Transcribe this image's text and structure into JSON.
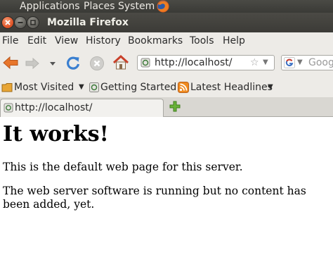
{
  "panel": {
    "applications": "Applications",
    "places": "Places",
    "system": "System",
    "bg_color": "#3c3b37",
    "logo_icon": "firefox-logo-icon"
  },
  "window": {
    "title": "Mozilla Firefox",
    "controls": [
      "close-icon",
      "minimize-icon",
      "maximize-icon"
    ],
    "close_color": "#e2572a"
  },
  "menubar": {
    "items": [
      "File",
      "Edit",
      "View",
      "History",
      "Bookmarks",
      "Tools",
      "Help"
    ]
  },
  "navbar": {
    "back_icon": "back-arrow-icon",
    "back_color": "#e8762b",
    "forward_icon": "forward-arrow-icon",
    "history_dropdown_icon": "chevron-down-icon",
    "reload_icon": "reload-icon",
    "reload_color": "#3a7fd0",
    "stop_icon": "stop-icon",
    "home_icon": "home-icon",
    "url": "http://localhost/",
    "bookmark_star_icon": "star-icon",
    "search_engine_icon": "google-icon",
    "search_placeholder": "Goog"
  },
  "bookmarks": {
    "items": [
      {
        "label": "Most Visited",
        "icon": "most-visited-icon",
        "dropdown": true
      },
      {
        "label": "Getting Started",
        "icon": "page-icon",
        "dropdown": false
      },
      {
        "label": "Latest Headlines",
        "icon": "rss-icon",
        "dropdown": true
      }
    ]
  },
  "tabs": {
    "items": [
      {
        "label": "http://localhost/",
        "active": true
      }
    ],
    "new_tab_icon": "plus-icon",
    "new_tab_color": "#6ab23a"
  },
  "page": {
    "heading": "It works!",
    "paragraphs": [
      "This is the default web page for this server.",
      "The web server software is running but no content has been added, yet."
    ]
  }
}
